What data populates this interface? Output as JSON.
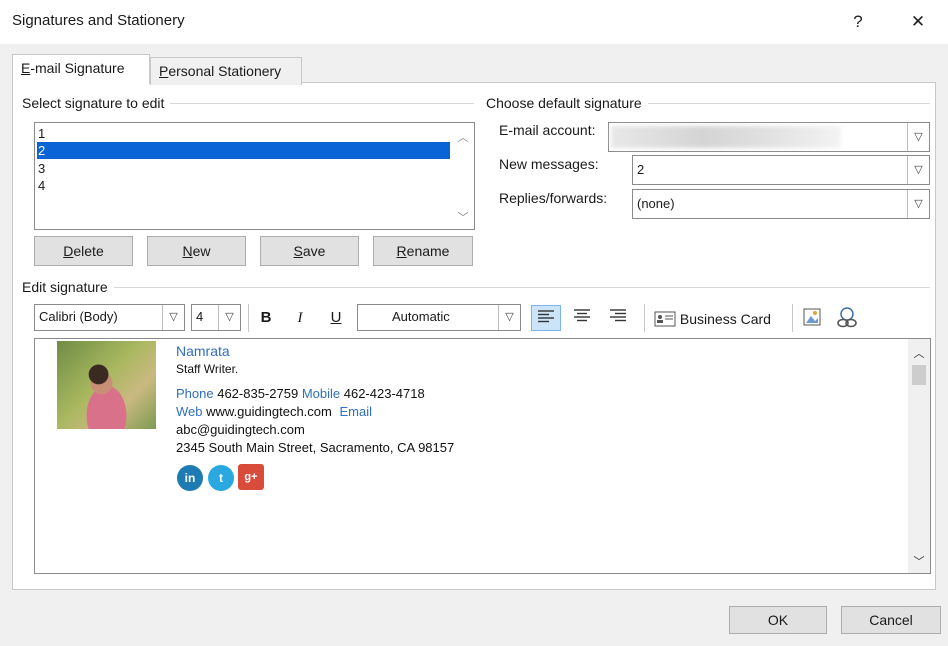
{
  "window": {
    "title": "Signatures and Stationery",
    "help": "?",
    "close": "✕"
  },
  "tabs": [
    {
      "label": "E-mail Signature",
      "underline": "E",
      "rest": "-mail Signature"
    },
    {
      "label": "Personal Stationery",
      "underline": "P",
      "rest": "ersonal Stationery"
    }
  ],
  "select_signature": {
    "label": "Select signature to edit",
    "items": [
      "1",
      "2",
      "3",
      "4"
    ],
    "selected_index": 1
  },
  "actions": {
    "delete": {
      "u": "D",
      "rest": "elete"
    },
    "new": {
      "u": "N",
      "rest": "ew"
    },
    "save": {
      "u": "S",
      "rest": "ave"
    },
    "rename": {
      "u": "R",
      "rest": "ename"
    }
  },
  "default_signature": {
    "label": "Choose default signature",
    "email_account_label": "E-mail account:",
    "new_messages_label": "New messages:",
    "new_messages_value": "2",
    "replies_label": "Replies/forwards:",
    "replies_value": "(none)"
  },
  "edit_signature": {
    "label": "Edit signature",
    "font": "Calibri (Body)",
    "size": "4",
    "bold": "B",
    "italic": "I",
    "underline": "U",
    "color": "Automatic",
    "business_card": "Business Card"
  },
  "signature": {
    "name": "Namrata",
    "role": "Staff Writer.",
    "phone_label": "Phone",
    "phone": "462-835-2759",
    "mobile_label": "Mobile",
    "mobile": "462-423-4718",
    "web_label": "Web",
    "web": "www.guidingtech.com",
    "email_label": "Email",
    "email": "abc@guidingtech.com",
    "address": "2345 South Main Street, Sacramento, CA 98157",
    "social": [
      "in",
      "t",
      "g+"
    ]
  },
  "footer": {
    "ok": "OK",
    "cancel": "Cancel"
  },
  "colors": {
    "selection": "#0a64d6",
    "link": "#2e6fbf",
    "linkedin": "#1f7bb3",
    "twitter": "#2aa9e0",
    "gplus": "#d94b3a"
  }
}
